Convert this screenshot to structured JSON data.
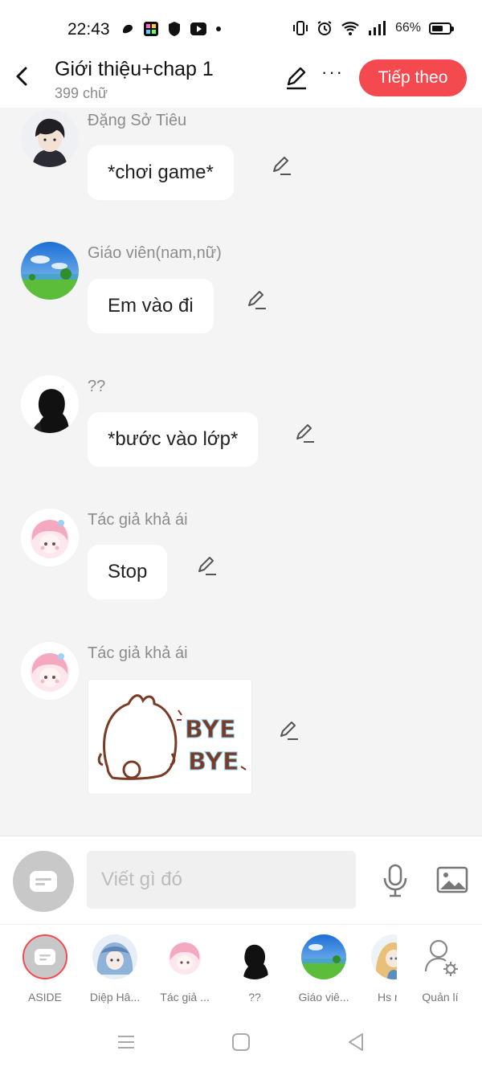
{
  "status_bar": {
    "time": "22:43",
    "battery": "66%",
    "battery_level": 0.66
  },
  "header": {
    "title": "Giới thiệu+chap 1",
    "word_count": "399 chữ",
    "next_label": "Tiếp theo"
  },
  "messages": [
    {
      "sender": "Đặng Sở Tiêu",
      "text": "*chơi game*",
      "avatar": "boy-avatar"
    },
    {
      "sender": "Giáo viên(nam,nữ)",
      "text": "Em vào đi",
      "avatar": "landscape-avatar"
    },
    {
      "sender": "??",
      "text": "*bước vào lớp*",
      "avatar": "silhouette-avatar"
    },
    {
      "sender": "Tác giả khả ái",
      "text": "Stop",
      "avatar": "pink-girl-avatar"
    },
    {
      "sender": "Tác giả khả ái",
      "sticker_text": "BYE BYE",
      "avatar": "pink-girl-avatar"
    }
  ],
  "input": {
    "placeholder": "Viết gì đó"
  },
  "characters": [
    {
      "label": "ASIDE",
      "icon": "aside-icon"
    },
    {
      "label": "Diệp Hâ...",
      "icon": "blue-girl-avatar"
    },
    {
      "label": "Tác giả ...",
      "icon": "pink-girl-avatar"
    },
    {
      "label": "??",
      "icon": "silhouette-avatar"
    },
    {
      "label": "Giáo viê...",
      "icon": "landscape-avatar"
    },
    {
      "label": "Hs r",
      "icon": "blonde-avatar"
    },
    {
      "label": "Quản lí",
      "icon": "manage-icon"
    }
  ]
}
